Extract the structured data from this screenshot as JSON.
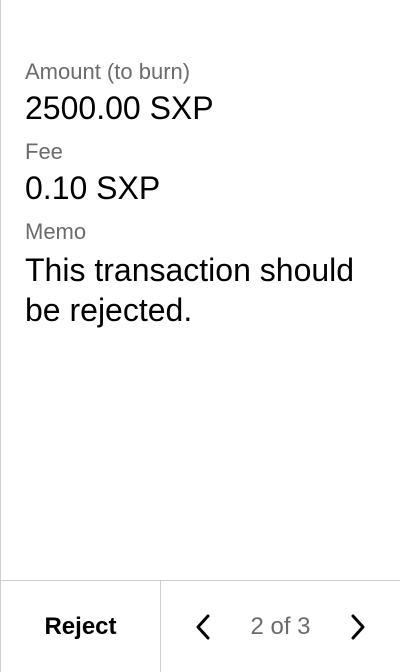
{
  "fields": {
    "amount_label": "Amount (to burn)",
    "amount_value": "2500.00 SXP",
    "fee_label": "Fee",
    "fee_value": "0.10 SXP",
    "memo_label": "Memo",
    "memo_value": "This transaction should be rejected."
  },
  "footer": {
    "reject_label": "Reject",
    "page_indicator": "2 of 3",
    "icons": {
      "prev": "chevron-left-icon",
      "next": "chevron-right-icon"
    }
  },
  "colors": {
    "text": "#000000",
    "muted_text": "#6b6b6b",
    "divider": "#cfcfcf",
    "background": "#ffffff"
  }
}
